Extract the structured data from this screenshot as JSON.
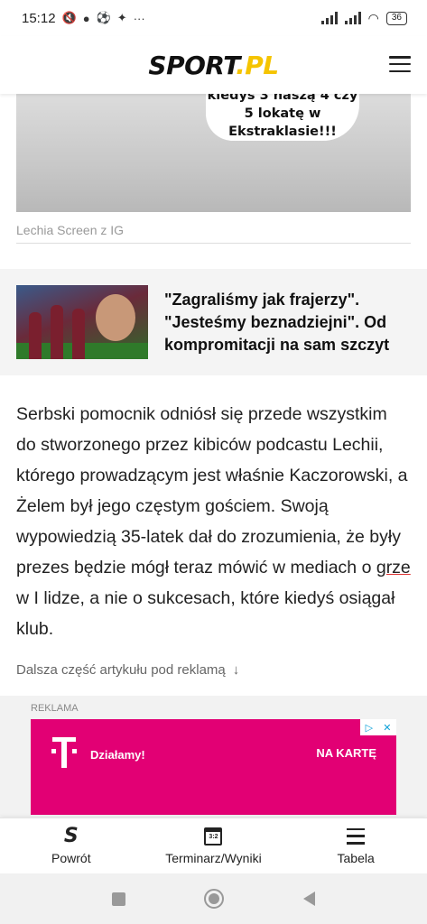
{
  "status_bar": {
    "time": "15:12",
    "notification_icons": [
      "muted-icon",
      "chat-icon",
      "ball-icon",
      "twitter-icon",
      "more-dots-icon"
    ],
    "battery": "36"
  },
  "header": {
    "logo_part1": "SPORT",
    "logo_part2": ".PL",
    "menu_icon": "hamburger-icon"
  },
  "hero": {
    "image_text_lines": [
      "kiedyś 3 naszą 4 czy",
      "5 lokatę w",
      "Ekstraklasie!!!"
    ],
    "caption": "Lechia Screen z IG"
  },
  "related": {
    "title": "\"Zagraliśmy jak frajerzy\". \"Jesteśmy beznadziejni\". Od kompromitacji na sam szczyt"
  },
  "article": {
    "text_before": "Serbski pomocnik odniósł się przede wszystkim do stworzonego przez kibiców podcastu Lechii, którego prowadzącym jest właśnie Kaczorowski, a Żelem był jego częstym gościem. Swoją wypowiedzią 35-latek dał do zrozumienia, że były prezes będzie mógł teraz mówić w mediach o ",
    "text_err": "grze",
    "text_after": " w I lidze, a nie o sukcesach, które kiedyś osiągał klub.",
    "more_label": "Dalsza część artykułu pod reklamą",
    "more_arrow": "↓"
  },
  "ad": {
    "label": "REKLAMA",
    "text": "Działamy!",
    "cta": "NA KARTĘ",
    "brand_color": "#e20074"
  },
  "bottom_nav": {
    "items": [
      {
        "label": "Powrót",
        "icon": "sport-s-icon"
      },
      {
        "label": "Terminarz/Wyniki",
        "icon": "calendar-icon",
        "icon_text": "3:2"
      },
      {
        "label": "Tabela",
        "icon": "list-icon"
      }
    ]
  }
}
